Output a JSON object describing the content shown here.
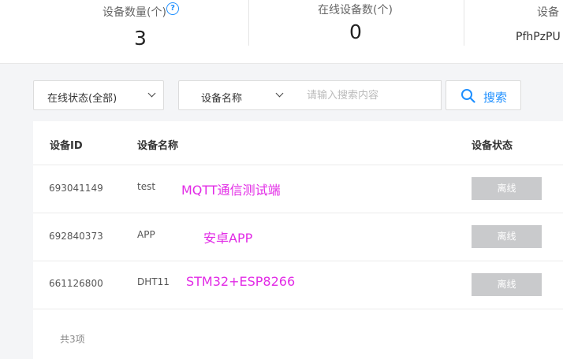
{
  "stats": {
    "device_count_label": "设备数量(个)",
    "device_count_value": "3",
    "online_count_label": "在线设备数(个)",
    "online_count_value": "0",
    "third_label": "设备",
    "third_value": "PfhPzPU"
  },
  "filters": {
    "status_select": "在线状态(全部)",
    "field_select": "设备名称",
    "search_placeholder": "请输入搜索内容",
    "search_button": "搜索"
  },
  "table": {
    "columns": [
      "设备ID",
      "设备名称",
      "设备状态"
    ],
    "rows": [
      {
        "id": "693041149",
        "name": "test",
        "note": "MQTT通信测试端",
        "status": "离线"
      },
      {
        "id": "692840373",
        "name": "APP",
        "note": "安卓APP",
        "status": "离线"
      },
      {
        "id": "661126800",
        "name": "DHT11",
        "note": "STM32+ESP8266",
        "status": "离线"
      }
    ],
    "total": "共3项"
  },
  "colors": {
    "accent": "#1e8fff",
    "annotation": "#e22be6",
    "offline_badge": "#c9cacc"
  }
}
